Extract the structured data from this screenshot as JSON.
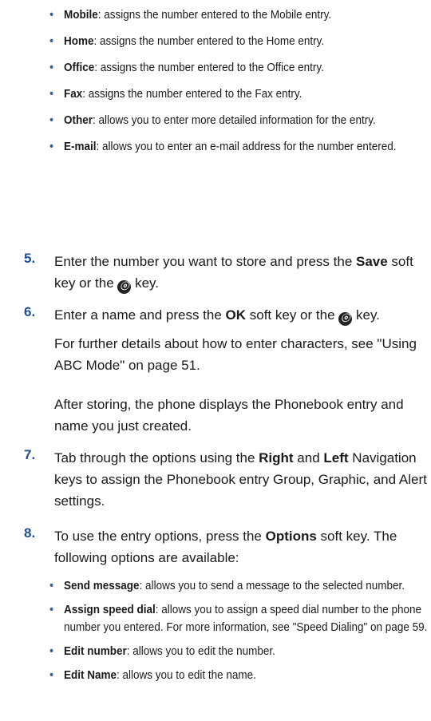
{
  "type_options": [
    {
      "term": "Mobile",
      "desc": ": assigns the number entered to the Mobile entry."
    },
    {
      "term": "Home",
      "desc": ": assigns the number entered to the Home entry."
    },
    {
      "term": "Office",
      "desc": ": assigns the number entered to the Office entry."
    },
    {
      "term": "Fax",
      "desc": ": assigns the number entered to the Fax entry."
    },
    {
      "term": "Other",
      "desc": ": allows you to enter more detailed information for the entry."
    },
    {
      "term": "E-mail",
      "desc": ": allows you to enter an e-mail address for the number entered."
    }
  ],
  "steps": {
    "s5": {
      "num": "5.",
      "a": "Enter the number you want to store and press the ",
      "b1": "Save",
      "c": " soft key or the ",
      "d": " key."
    },
    "s6": {
      "num": "6.",
      "a": "Enter a name and press the ",
      "b1": "OK",
      "c": " soft key or the ",
      "d": " key.",
      "p1": "For further details about how to enter characters, see \"Using ABC Mode\" on page 51.",
      "p2": "After storing, the phone displays the Phonebook entry and name you just created."
    },
    "s7": {
      "num": "7.",
      "a": "Tab through the options using the ",
      "b1": "Right",
      "c": " and ",
      "b2": "Left",
      "d": " Navigation keys to assign the Phonebook entry Group, Graphic, and Alert settings."
    },
    "s8": {
      "num": "8.",
      "a": "To use the entry options, press the ",
      "b1": "Options",
      "c": " soft key. The following options are available:"
    }
  },
  "entry_options": [
    {
      "term": "Send message",
      "desc": ": allows you to send a message to the selected number."
    },
    {
      "term": "Assign speed dial",
      "desc": ": allows you to assign a speed dial number to the phone number you entered. For more information, see \"Speed Dialing\" on page 59."
    },
    {
      "term": "Edit number",
      "desc": ": allows you to edit the number."
    },
    {
      "term": "Edit Name",
      "desc": ": allows you to edit the name."
    }
  ],
  "key_icon": "ok-key-icon"
}
